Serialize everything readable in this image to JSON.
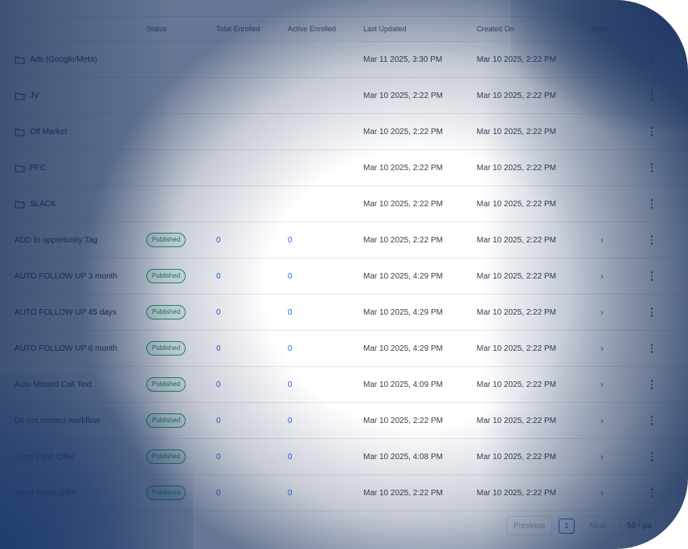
{
  "table": {
    "headers": {
      "name": "",
      "status": "Status",
      "total": "Total Enrolled",
      "active": "Active Enrolled",
      "updated": "Last Updated",
      "created": "Created On",
      "stats": "Stats"
    },
    "folders": [
      {
        "name": "Ads (Google/Meta)",
        "updated": "Mar 11 2025, 3:30 PM",
        "created": "Mar 10 2025, 2:22 PM"
      },
      {
        "name": "JV",
        "updated": "Mar 10 2025, 2:22 PM",
        "created": "Mar 10 2025, 2:22 PM"
      },
      {
        "name": "Off Market",
        "updated": "Mar 10 2025, 2:22 PM",
        "created": "Mar 10 2025, 2:22 PM"
      },
      {
        "name": "PFC",
        "updated": "Mar 10 2025, 2:22 PM",
        "created": "Mar 10 2025, 2:22 PM"
      },
      {
        "name": "SLACK",
        "updated": "Mar 10 2025, 2:22 PM",
        "created": "Mar 10 2025, 2:22 PM"
      }
    ],
    "workflows": [
      {
        "name": "ADD to opportunity Tag",
        "status": "Published",
        "total": "0",
        "active": "0",
        "updated": "Mar 10 2025, 2:22 PM",
        "created": "Mar 10 2025, 2:22 PM"
      },
      {
        "name": "AUTO FOLLOW UP 3 month",
        "status": "Published",
        "total": "0",
        "active": "0",
        "updated": "Mar 10 2025, 4:29 PM",
        "created": "Mar 10 2025, 2:22 PM"
      },
      {
        "name": "AUTO FOLLOW UP 45 days",
        "status": "Published",
        "total": "0",
        "active": "0",
        "updated": "Mar 10 2025, 4:29 PM",
        "created": "Mar 10 2025, 2:22 PM"
      },
      {
        "name": "AUTO FOLLOW UP 6 month",
        "status": "Published",
        "total": "0",
        "active": "0",
        "updated": "Mar 10 2025, 4:29 PM",
        "created": "Mar 10 2025, 2:22 PM"
      },
      {
        "name": "Auto Missed Call Text",
        "status": "Published",
        "total": "0",
        "active": "0",
        "updated": "Mar 10 2025, 4:09 PM",
        "created": "Mar 10 2025, 2:22 PM"
      },
      {
        "name": "Do not contact workflow",
        "status": "Published",
        "total": "0",
        "active": "0",
        "updated": "Mar 10 2025, 2:22 PM",
        "created": "Mar 10 2025, 2:22 PM"
      },
      {
        "name": "Send Cash Offer",
        "status": "Published",
        "total": "0",
        "active": "0",
        "updated": "Mar 10 2025, 4:08 PM",
        "created": "Mar 10 2025, 2:22 PM"
      },
      {
        "name": "Send Subto Offer",
        "status": "Published",
        "total": "0",
        "active": "0",
        "updated": "Mar 10 2025, 2:22 PM",
        "created": "Mar 10 2025, 2:22 PM"
      }
    ]
  },
  "pagination": {
    "previous": "Previous",
    "page": "1",
    "next": "Next",
    "per_page": "50 / pa"
  },
  "colors": {
    "published_border": "#22a06b",
    "link_blue": "#2563eb"
  },
  "icons": {
    "folder": "folder-icon",
    "row_menu": "more-vertical-icon",
    "row_arrow": "chevron-right-icon",
    "stats_info": "info-icon"
  }
}
